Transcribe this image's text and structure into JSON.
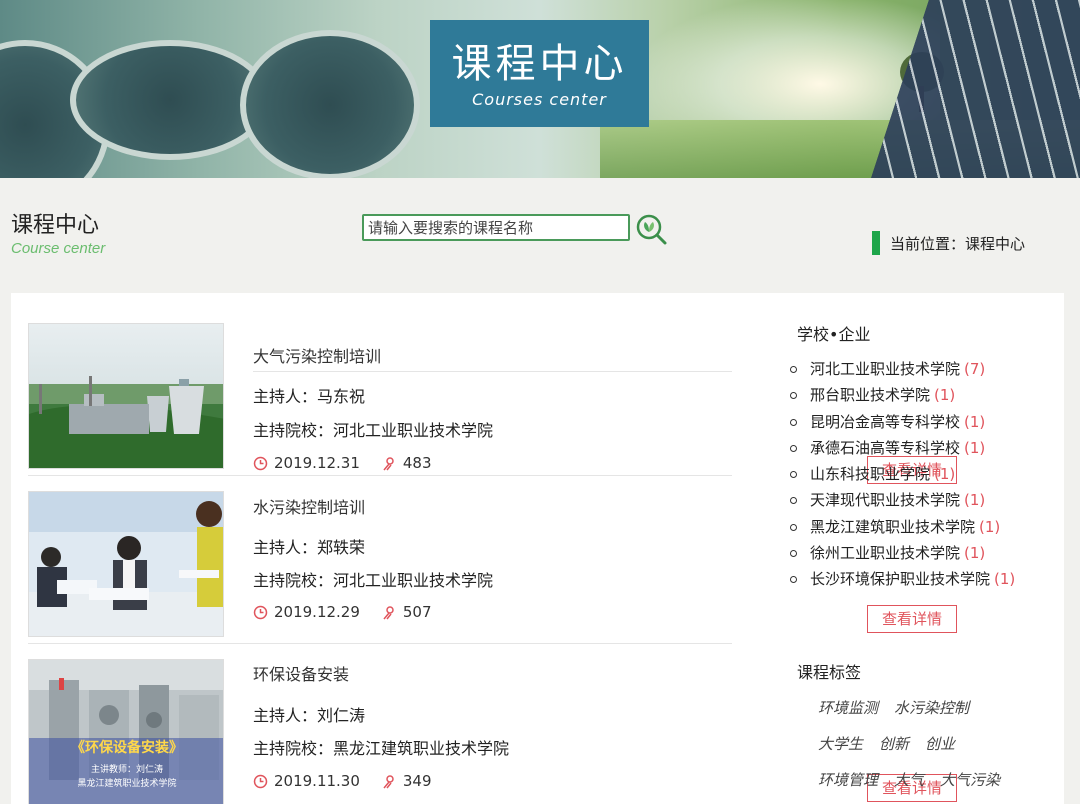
{
  "banner": {
    "title_cn": "课程中心",
    "title_en": "Courses center"
  },
  "header": {
    "title": "课程中心",
    "subtitle": "Course center"
  },
  "search": {
    "placeholder": "请输入要搜索的课程名称"
  },
  "breadcrumb": {
    "label": "当前位置：",
    "current": "课程中心"
  },
  "courses": [
    {
      "title": "大气污染控制培训",
      "host": "主持人：马东祝",
      "school": "主持院校：河北工业职业技术学院",
      "date": "2019.12.31",
      "count": "483",
      "button": "查看详情"
    },
    {
      "title": "水污染控制培训",
      "host": "主持人：郑轶荣",
      "school": "主持院校：河北工业职业技术学院",
      "date": "2019.12.29",
      "count": "507",
      "button": "查看详情"
    },
    {
      "title": "环保设备安装",
      "host": "主持人：刘仁涛",
      "school": "主持院校：黑龙江建筑职业技术学院",
      "date": "2019.11.30",
      "count": "349",
      "button": "查看详情"
    }
  ],
  "course3_thumb_text": {
    "headline": "《环保设备安装》",
    "line1": "主讲教师：刘仁涛",
    "line2": "黑龙江建筑职业技术学院"
  },
  "sidebar": {
    "schools_heading": "学校•企业",
    "schools": [
      {
        "name": "河北工业职业技术学院",
        "count": "(7)"
      },
      {
        "name": "邢台职业技术学院",
        "count": "(1)"
      },
      {
        "name": "昆明冶金高等专科学校",
        "count": "(1)"
      },
      {
        "name": "承德石油高等专科学校",
        "count": "(1)"
      },
      {
        "name": "山东科技职业学院",
        "count": "(1)"
      },
      {
        "name": "天津现代职业技术学院",
        "count": "(1)"
      },
      {
        "name": "黑龙江建筑职业技术学院",
        "count": "(1)"
      },
      {
        "name": "徐州工业职业技术学院",
        "count": "(1)"
      },
      {
        "name": "长沙环境保护职业技术学院",
        "count": "(1)"
      }
    ],
    "tags_heading": "课程标签",
    "tags": [
      [
        "环境监测",
        "水污染控制"
      ],
      [
        "大学生",
        "创新",
        "创业"
      ],
      [
        "环境管理",
        "大气",
        "大气污染"
      ]
    ]
  },
  "colors": {
    "accent_green": "#1ea64a",
    "accent_red": "#e0545c",
    "banner_blue": "#2f7a98"
  }
}
